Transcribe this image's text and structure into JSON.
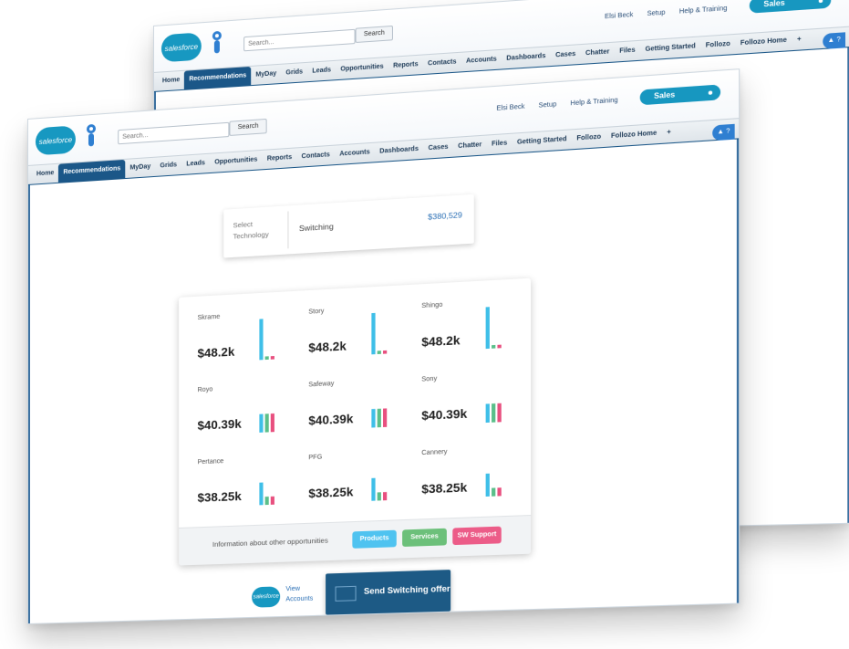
{
  "header": {
    "logo_text": "salesforce",
    "search_placeholder": "Search...",
    "search_button": "Search",
    "user_menu": "Elsi Beck",
    "setup_link": "Setup",
    "help_link": "Help & Training",
    "app_switcher": "Sales",
    "help_badge": "▲ ?"
  },
  "nav": {
    "tabs": [
      "Home",
      "Recommendations",
      "MyDay",
      "Grids",
      "Leads",
      "Opportunities",
      "Reports",
      "Contacts",
      "Accounts",
      "Dashboards",
      "Cases",
      "Chatter",
      "Files",
      "Getting Started",
      "Follozo",
      "Follozo Home",
      "+"
    ],
    "active_index": 1
  },
  "technology": {
    "label": "Select Technology",
    "value": "Switching",
    "amount": "$380,529"
  },
  "opportunities": [
    {
      "name": "Skrame",
      "value": "$48.2k",
      "bars": [
        1.0,
        0.08,
        0.08
      ]
    },
    {
      "name": "Story",
      "value": "$48.2k",
      "bars": [
        1.0,
        0.08,
        0.08
      ]
    },
    {
      "name": "Shingo",
      "value": "$48.2k",
      "bars": [
        1.0,
        0.08,
        0.08
      ]
    },
    {
      "name": "Royo",
      "value": "$40.39k",
      "bars": [
        0.45,
        0.45,
        0.45
      ]
    },
    {
      "name": "Safeway",
      "value": "$40.39k",
      "bars": [
        0.45,
        0.45,
        0.45
      ]
    },
    {
      "name": "Sony",
      "value": "$40.39k",
      "bars": [
        0.45,
        0.45,
        0.45
      ]
    },
    {
      "name": "Pertance",
      "value": "$38.25k",
      "bars": [
        0.55,
        0.2,
        0.2
      ]
    },
    {
      "name": "PFG",
      "value": "$38.25k",
      "bars": [
        0.55,
        0.2,
        0.2
      ]
    },
    {
      "name": "Cannery",
      "value": "$38.25k",
      "bars": [
        0.55,
        0.2,
        0.2
      ]
    }
  ],
  "footer": {
    "info_text": "Information about other opportunities",
    "products_button": "Products",
    "services_button": "Services",
    "support_button": "SW Support"
  },
  "actions": {
    "view_accounts": "View Accounts",
    "send_offer": "Send Switching offer"
  },
  "colors": {
    "bar_blue": "#3fbfe8",
    "bar_green": "#5bbf8a",
    "bar_pink": "#e8507f",
    "nav_active": "#1b5788",
    "send_button": "#1d5a85"
  }
}
